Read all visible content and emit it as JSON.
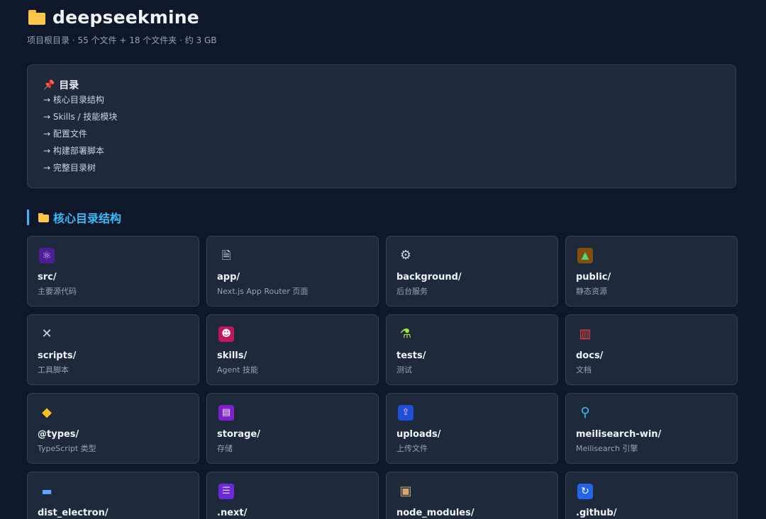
{
  "header": {
    "title": "deepseekmine",
    "subtitle": "项目根目录 · 55 个文件 + 18 个文件夹 · 约 3 GB"
  },
  "toc": {
    "title": "目录",
    "links": [
      "→ 核心目录结构",
      "→ Skills / 技能模块",
      "→ 配置文件",
      "→ 构建部署脚本",
      "→ 完整目录树"
    ]
  },
  "section": {
    "title": "核心目录结构"
  },
  "cards": [
    {
      "name": "src/",
      "desc": "主要源代码",
      "icon": "react-atom-icon",
      "color": "#8b5cf6"
    },
    {
      "name": "app/",
      "desc": "Next.js App Router 页面",
      "icon": "page-icon",
      "color": "#e2e8f0"
    },
    {
      "name": "background/",
      "desc": "后台服务",
      "icon": "gear-icon",
      "color": "#cbd5e1"
    },
    {
      "name": "public/",
      "desc": "静态资源",
      "icon": "picture-icon",
      "color": "#4ade80"
    },
    {
      "name": "scripts/",
      "desc": "工具脚本",
      "icon": "tools-icon",
      "color": "#cbd5e1"
    },
    {
      "name": "skills/",
      "desc": "Agent 技能",
      "icon": "robot-icon",
      "color": "#f472b6"
    },
    {
      "name": "tests/",
      "desc": "测试",
      "icon": "test-tube-icon",
      "color": "#a3e635"
    },
    {
      "name": "docs/",
      "desc": "文档",
      "icon": "books-icon",
      "color": "#ef4444"
    },
    {
      "name": "@types/",
      "desc": "TypeScript 类型",
      "icon": "label-tag-icon",
      "color": "#fbbf24"
    },
    {
      "name": "storage/",
      "desc": "存储",
      "icon": "floppy-disk-icon",
      "color": "#c084fc"
    },
    {
      "name": "uploads/",
      "desc": "上传文件",
      "icon": "outbox-tray-icon",
      "color": "#60a5fa"
    },
    {
      "name": "meilisearch-win/",
      "desc": "Meilisearch 引擎",
      "icon": "magnifier-icon",
      "color": "#38bdf8"
    },
    {
      "name": "dist_electron/",
      "desc": "",
      "icon": "desktop-computer-icon",
      "color": "#60a5fa"
    },
    {
      "name": ".next/",
      "desc": "",
      "icon": "file-cabinet-icon",
      "color": "#a78bfa"
    },
    {
      "name": "node_modules/",
      "desc": "",
      "icon": "package-icon",
      "color": "#d6a86b"
    },
    {
      "name": ".github/",
      "desc": "",
      "icon": "refresh-arrows-icon",
      "color": "#3b82f6"
    }
  ]
}
